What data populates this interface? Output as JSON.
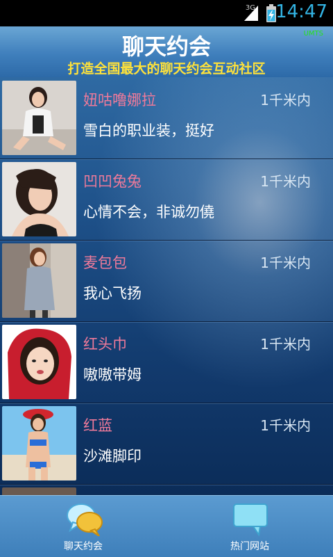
{
  "status_bar": {
    "network": "3G",
    "time": "14:47"
  },
  "header": {
    "title": "聊天约会",
    "subtitle": "打造全国最大的聊天约会互动社区",
    "network_badge": "UMTS"
  },
  "contacts": [
    {
      "name": "妞咕噜娜拉",
      "distance": "1千米内",
      "status": "雪白的职业装，挺好"
    },
    {
      "name": "凹凹兔兔",
      "distance": "1千米内",
      "status": "心情不会，非诚勿僥"
    },
    {
      "name": "麦包包",
      "distance": "1千米内",
      "status": "我心飞扬"
    },
    {
      "name": "红头巾",
      "distance": "1千米内",
      "status": "嗷嗷带姆"
    },
    {
      "name": "红蓝",
      "distance": "1千米内",
      "status": "沙滩脚印"
    }
  ],
  "bottom_tabs": [
    {
      "label": "聊天约会",
      "icon": "chat-bubbles-icon"
    },
    {
      "label": "热门网站",
      "icon": "speech-bubble-icon"
    }
  ],
  "colors": {
    "name": "#f07a9a",
    "subtitle": "#ffe23a",
    "clock": "#33b5e5"
  }
}
